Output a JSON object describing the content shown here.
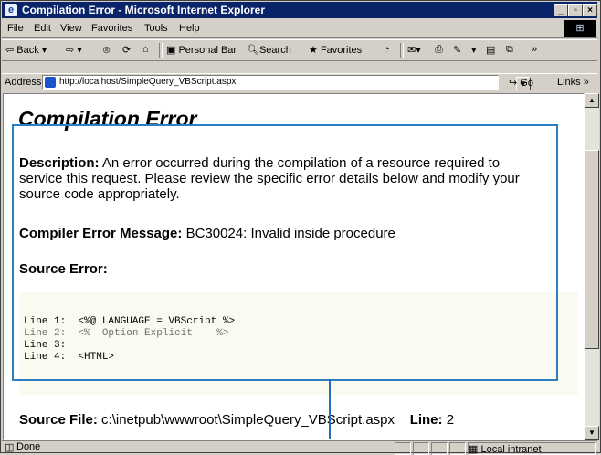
{
  "window": {
    "title": "Compilation Error - Microsoft Internet Explorer",
    "controls": {
      "minimize": "_",
      "maximize": "▫",
      "close": "×"
    }
  },
  "menu": [
    "File",
    "Edit",
    "View",
    "Favorites",
    "Tools",
    "Help"
  ],
  "toolbar": {
    "back": "Back",
    "personal_bar": "Personal Bar",
    "search": "Search",
    "favorites": "Favorites"
  },
  "address": {
    "label": "Address",
    "url": "http://localhost/SimpleQuery_VBScript.aspx",
    "go": "Go",
    "links": "Links"
  },
  "page": {
    "heading": "Compilation Error",
    "description_label": "Description:",
    "description_lines": [
      "An error occurred during the compilation of a resource required to",
      "service this request. Please review the specific error details below and modify your",
      "source code appropriately."
    ],
    "compiler_label": "Compiler Error Message:",
    "compiler_message": "BC30024: Invalid inside procedure",
    "source_error_label": "Source Error:",
    "code_lines": [
      {
        "num": "Line 1:",
        "code": "<%@ LANGUAGE = VBScript %>",
        "color": "#000000"
      },
      {
        "num": "Line 2:",
        "code": "<%  Option Explicit    %>",
        "color": "#707070"
      },
      {
        "num": "Line 3:",
        "code": "",
        "color": "#000000"
      },
      {
        "num": "Line 4:",
        "code": "<HTML>",
        "color": "#000000"
      }
    ],
    "source_file_label": "Source File:",
    "source_file": "c:\\inetpub\\wwwroot\\SimpleQuery_VBScript.aspx",
    "line_label": "Line:",
    "line_number": "2"
  },
  "status": {
    "text": "Done",
    "zone": "Local intranet"
  },
  "colors": {
    "callout": "#2b7fc0",
    "titlebar": "#0a246a"
  }
}
